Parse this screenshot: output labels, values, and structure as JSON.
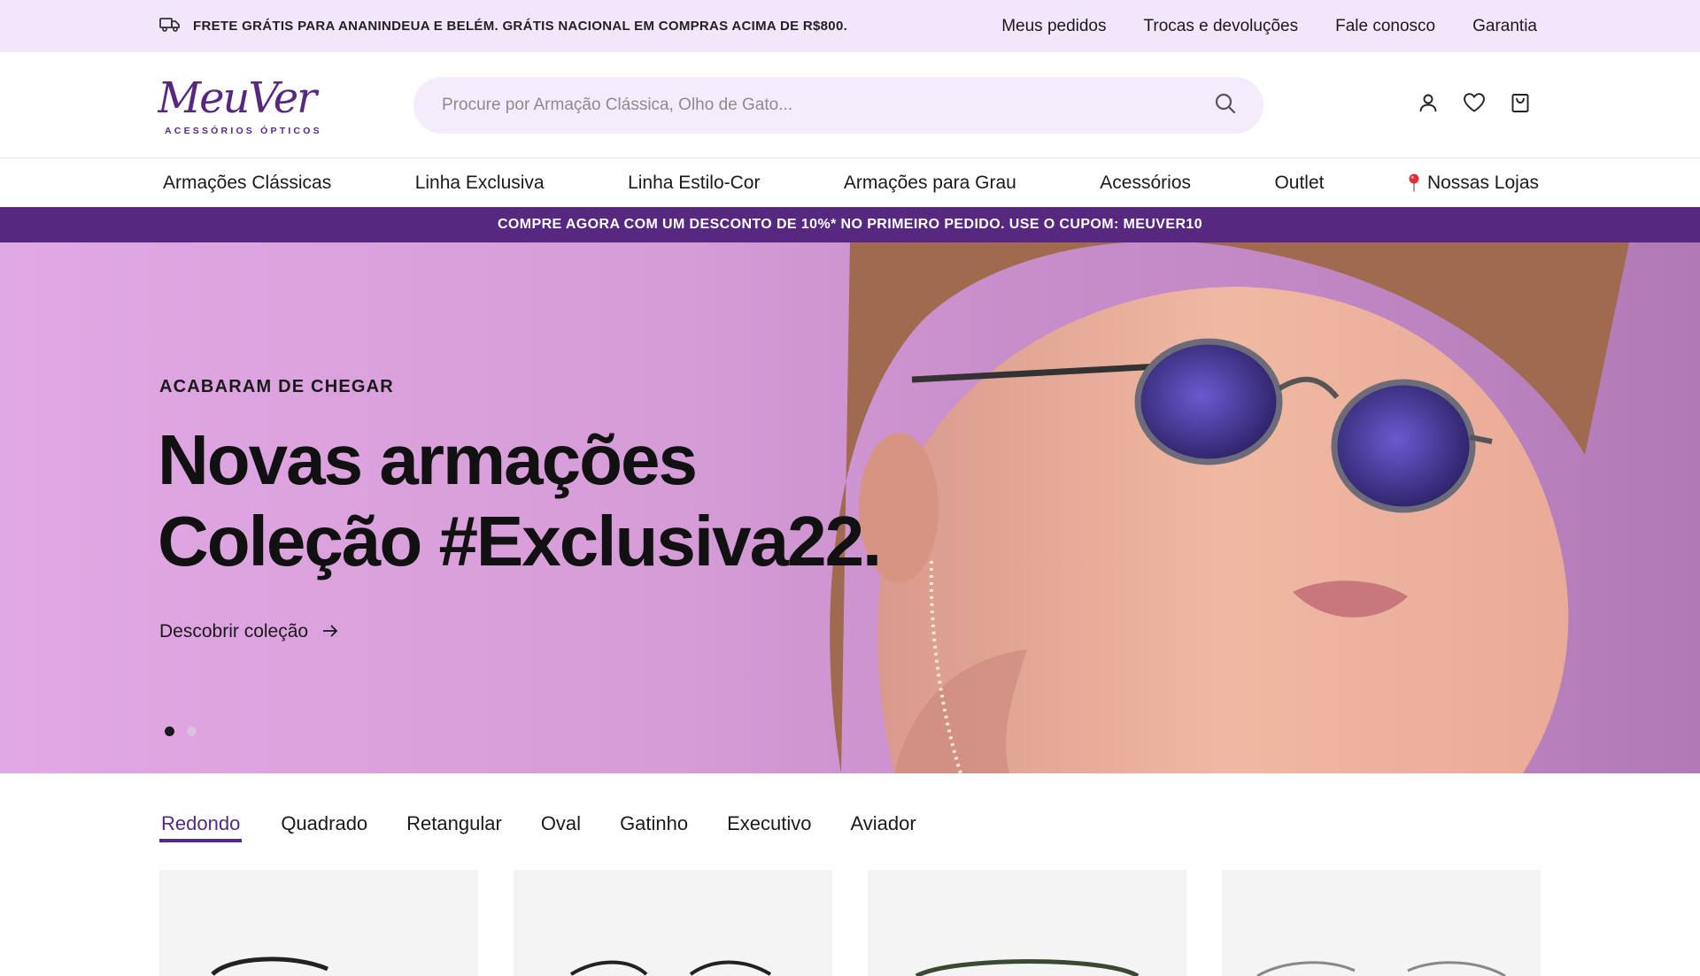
{
  "topbar": {
    "promo_text": "FRETE GRÁTIS PARA ANANINDEUA E BELÉM. GRÁTIS NACIONAL EM COMPRAS ACIMA DE R$800.",
    "links": [
      "Meus pedidos",
      "Trocas e devoluções",
      "Fale conosco",
      "Garantia"
    ]
  },
  "header": {
    "logo_text": "MeuVer",
    "logo_subtext": "ACESSÓRIOS ÓPTICOS",
    "search_placeholder": "Procure por Armação Clássica, Olho de Gato..."
  },
  "nav": {
    "items": [
      "Armações Clássicas",
      "Linha Exclusiva",
      "Linha Estilo-Cor",
      "Armações para Grau",
      "Acessórios",
      "Outlet",
      "Nossas Lojas"
    ]
  },
  "announcement": "COMPRE AGORA COM UM DESCONTO DE 10%* NO PRIMEIRO PEDIDO. USE O CUPOM: MEUVER10",
  "hero": {
    "eyebrow": "ACABARAM DE CHEGAR",
    "title_line1": "Novas armações",
    "title_line2": "Coleção #Exclusiva22.",
    "cta": "Descobrir coleção",
    "slides_total": 2,
    "active_slide": 1
  },
  "shape_tabs": {
    "items": [
      "Redondo",
      "Quadrado",
      "Retangular",
      "Oval",
      "Gatinho",
      "Executivo",
      "Aviador"
    ],
    "active": "Redondo"
  },
  "colors": {
    "accent": "#56287f",
    "topbar_bg": "#f1e6fb",
    "search_bg": "#f5ecfb"
  }
}
